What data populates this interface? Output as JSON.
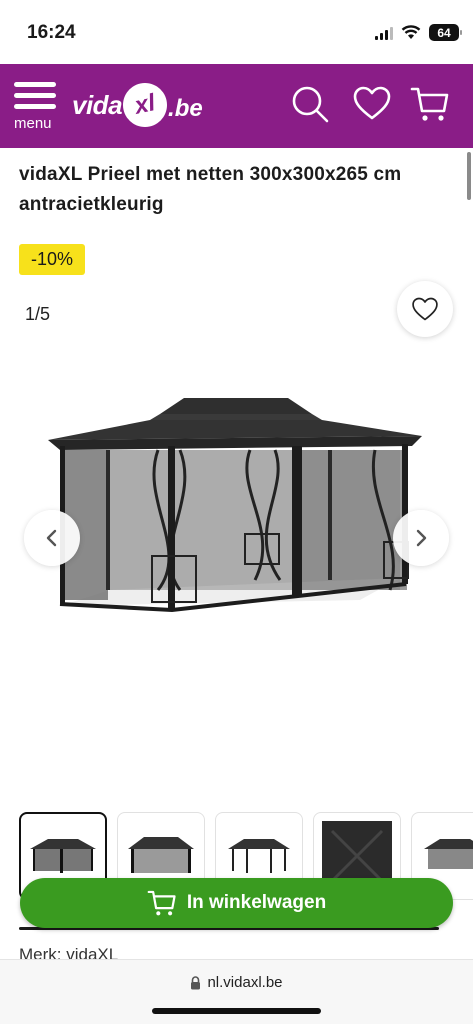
{
  "status": {
    "time": "16:24",
    "battery": "64"
  },
  "header": {
    "menu_label": "menu",
    "logo": {
      "part1": "vida",
      "part2": "xl",
      "part3": ".be"
    },
    "brand_color": "#8a1d87",
    "icons": [
      "search-icon",
      "heart-icon",
      "cart-icon"
    ]
  },
  "product": {
    "title": "vidaXL Prieel met netten 300x300x265 cm antracietkleurig",
    "discount": "-10%",
    "gallery_counter": "1/5",
    "brand_line": "Merk: vidaXL"
  },
  "thumbnails": [
    {
      "name": "thumb-1",
      "active": true
    },
    {
      "name": "thumb-2",
      "active": false
    },
    {
      "name": "thumb-3",
      "active": false
    },
    {
      "name": "thumb-4",
      "active": false
    },
    {
      "name": "thumb-5",
      "active": false
    }
  ],
  "actions": {
    "add_to_cart": "In winkelwagen",
    "cart_button_color": "#3a9b20"
  },
  "browser": {
    "url": "nl.vidaxl.be"
  }
}
